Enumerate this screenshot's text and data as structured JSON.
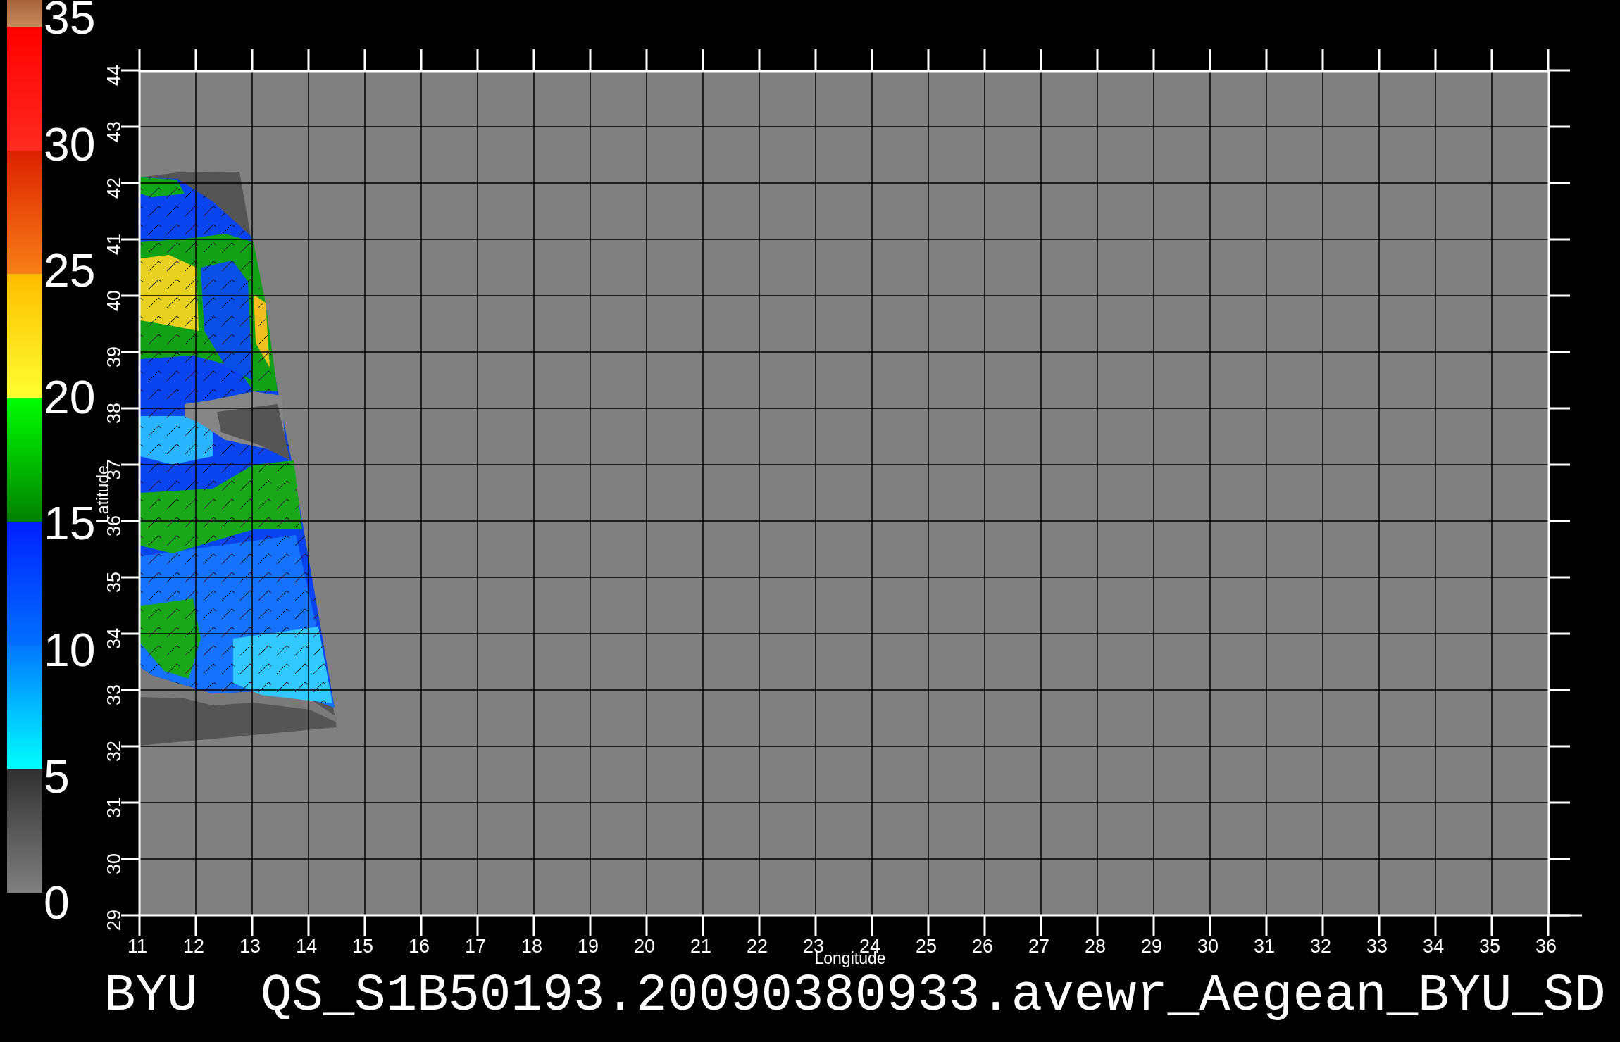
{
  "color_scale": {
    "labels": [
      "35",
      "30",
      "25",
      "20",
      "15",
      "10",
      "5",
      "0"
    ]
  },
  "map": {
    "y_axis": {
      "title": "Latitude",
      "ticks": [
        "44",
        "43",
        "42",
        "41",
        "40",
        "39",
        "38",
        "37",
        "36",
        "35",
        "34",
        "33",
        "32",
        "31",
        "30",
        "29"
      ]
    },
    "x_axis": {
      "title": "Longitude",
      "ticks": [
        "11",
        "12",
        "13",
        "14",
        "15",
        "16",
        "17",
        "18",
        "19",
        "20",
        "21",
        "22",
        "23",
        "24",
        "25",
        "26",
        "27",
        "28",
        "29",
        "30",
        "31",
        "32",
        "33",
        "34",
        "35",
        "36"
      ]
    }
  },
  "title": "BYU  QS_S1B50193.20090380933.avewr_Aegean_BYU_SD"
}
